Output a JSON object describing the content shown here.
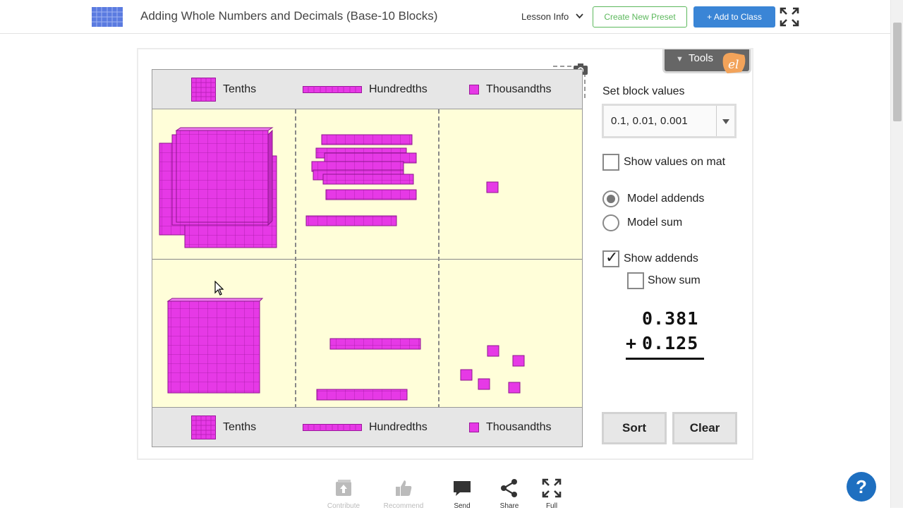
{
  "header": {
    "title": "Adding Whole Numbers and Decimals (Base-10 Blocks)",
    "lesson_info": "Lesson Info",
    "create_preset": "Create New Preset",
    "add_to_class": "+ Add to Class"
  },
  "mat": {
    "columns": [
      "Tenths",
      "Hundredths",
      "Thousandths"
    ],
    "bottom_columns": [
      "Tenths",
      "Hundredths",
      "Thousandths"
    ],
    "top_row": {
      "tenths": 4,
      "hundredths": 8,
      "thousandths": 1
    },
    "bottom_row": {
      "tenths": 1,
      "hundredths": 2,
      "thousandths": 5
    }
  },
  "tools": {
    "label": "Tools"
  },
  "panel": {
    "set_block_values": "Set block values",
    "block_values_selected": "0.1, 0.01, 0.001",
    "show_values_on_mat": "Show values on mat",
    "model_addends": "Model addends",
    "model_sum": "Model sum",
    "show_addends": "Show addends",
    "show_sum": "Show sum",
    "addend1": "0.381",
    "addend2": "0.125",
    "plus": "+",
    "sort": "Sort",
    "clear": "Clear",
    "state": {
      "show_values_on_mat": false,
      "model": "addends",
      "show_addends": true,
      "show_sum": false
    }
  },
  "bottom_bar": {
    "contribute": "Contribute",
    "recommend": "Recommend",
    "send": "Send",
    "share": "Share",
    "full": "Full"
  },
  "colors": {
    "block": "#e639e6",
    "block_edge": "#9b189b",
    "mat": "#fffed9",
    "accent_blue": "#3a85d6",
    "accent_green": "#5cb85c"
  }
}
